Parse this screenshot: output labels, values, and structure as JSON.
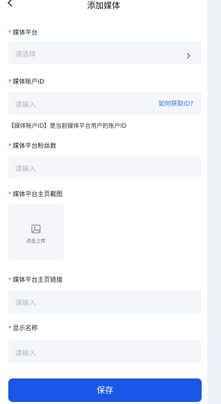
{
  "header": {
    "title": "添加媒体"
  },
  "form": {
    "platform": {
      "required_mark": "*",
      "label": "媒体平台",
      "placeholder": "请选择"
    },
    "account_id": {
      "required_mark": "*",
      "label": "媒体账户ID",
      "placeholder": "请输入",
      "help_link": "如何获取ID?",
      "hint": "【媒体账户ID】是当前媒体平台用户的账户ID"
    },
    "followers": {
      "required_mark": "*",
      "label": "媒体平台粉丝数",
      "placeholder": "请输入"
    },
    "screenshot": {
      "required_mark": "*",
      "label": "媒体平台主页截图",
      "upload_text": "点击上传"
    },
    "homepage_link": {
      "required_mark": "*",
      "label": "媒体平台主页链接",
      "placeholder": "请输入"
    },
    "display_name": {
      "required_mark": "*",
      "label": "显示名称",
      "placeholder": "请输入"
    }
  },
  "footer": {
    "save_label": "保存"
  },
  "colors": {
    "accent": "#1a56e8",
    "link": "#1f7ae0",
    "required": "#e53935"
  },
  "icons": [
    "chevron-left-icon",
    "chevron-right-icon",
    "image-icon"
  ]
}
